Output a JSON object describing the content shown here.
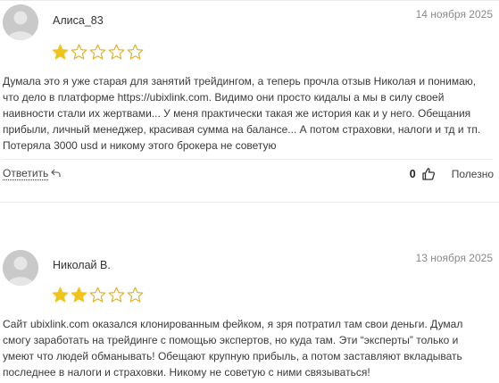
{
  "reviews": [
    {
      "author": "Алиса_83",
      "date": "14 ноября 2025",
      "rating": 1,
      "max_rating": 5,
      "text": "Думала это я уже старая для занятий трейдингом, а теперь прочла отзыв Николая и понимаю, что дело в платформе https://ubixlink.com. Видимо они просто кидалы а мы в силу своей наивности стали их жертвами... У меня практически такая же история как и у него. Обещания прибыли, личный менеджер, красивая сумма на балансе... А потом страховки, налоги и тд и тп. Потеряла 3000 usd и никому этого брокера не советую",
      "reply_label": "Ответить",
      "likes": "0",
      "helpful_label": "Полезно"
    },
    {
      "author": "Николай В.",
      "date": "13 ноября 2025",
      "rating": 2,
      "max_rating": 5,
      "text": "Сайт ubixlink.com оказался клонированным фейком, я зря потратил там свои деньги. Думал смогу заработать на трейдинге с помощью экспертов, но куда там. Эти “эксперты” только и умеют что людей обманывать! Обещают крупную прибыль, а потом заставляют вкладывать последнее в налоги и страховки. Никому не советую с ними связываться!"
    }
  ],
  "colors": {
    "star_filled": "#f2c31b",
    "star_outline": "#e0b020",
    "avatar_bg": "#c9c9c9",
    "date": "#8a8a8a"
  },
  "icons": {
    "reply": "reply-arrow-icon",
    "like": "thumbs-up-icon",
    "avatar": "user-avatar-icon"
  }
}
